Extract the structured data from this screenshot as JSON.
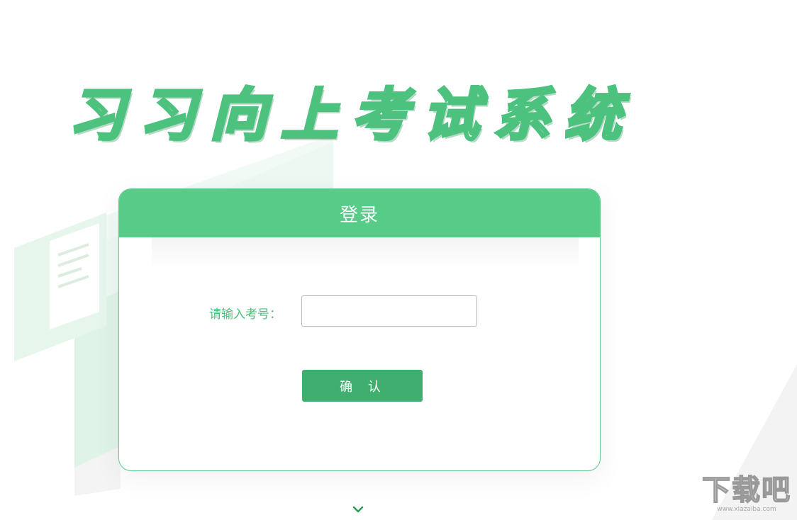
{
  "app": {
    "title": "习习向上考试系统"
  },
  "login": {
    "header_title": "登录",
    "exam_number_label": "请输入考号：",
    "exam_number_value": "",
    "exam_number_placeholder": "",
    "confirm_label": "确 认"
  },
  "navigation": {
    "scroll_icon": "chevron-down-icon"
  },
  "watermark": {
    "text": "下载吧",
    "url": "www.xiazaiba.com"
  },
  "colors": {
    "accent": "#56cc88",
    "button": "#3fae6e",
    "label": "#4cbf7a",
    "border": "#5ecb8a"
  }
}
